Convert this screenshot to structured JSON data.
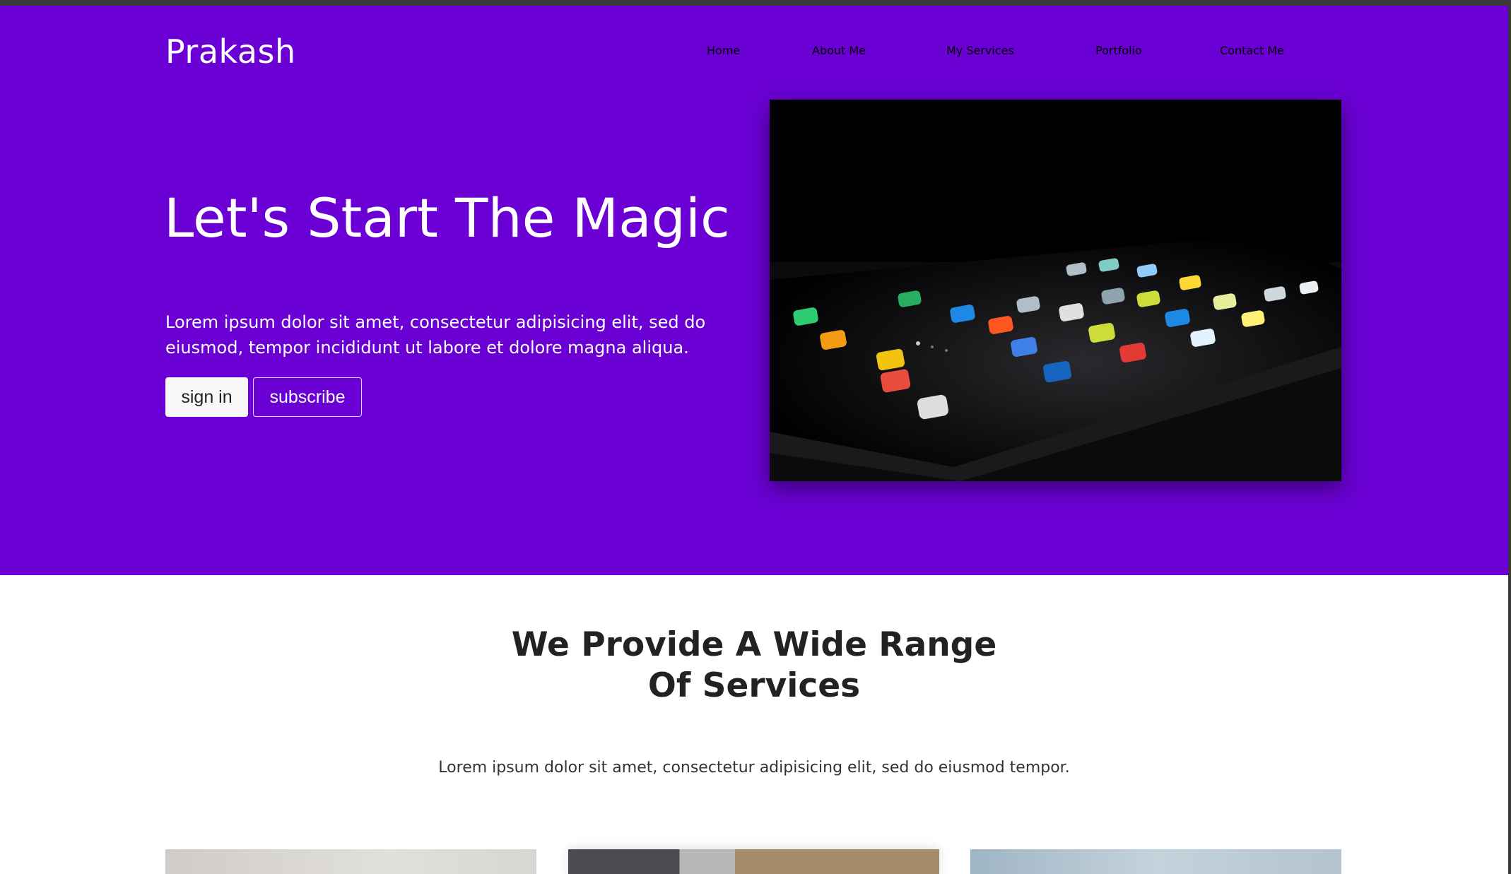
{
  "brand": "Prakash",
  "nav": {
    "items": [
      "Home",
      "About Me",
      "My Services",
      "Portfolio",
      "Contact Me"
    ]
  },
  "hero": {
    "title": "Let's Start The Magic",
    "text": "Lorem ipsum dolor sit amet, consectetur adipisicing elit, sed do eiusmod, tempor incididunt ut labore et dolore magna aliqua.",
    "signin_label": "sign in",
    "subscribe_label": "subscribe",
    "image_alt": "smartphone-with-app-icons-photo"
  },
  "services": {
    "title_line1": "We Provide A Wide Range",
    "title_line2": "Of Services",
    "text": "Lorem ipsum dolor sit amet, consectetur adipisicing elit, sed do eiusmod tempor."
  },
  "colors": {
    "hero_bg": "#6a00d4",
    "text_dark": "#222222",
    "white": "#ffffff"
  }
}
